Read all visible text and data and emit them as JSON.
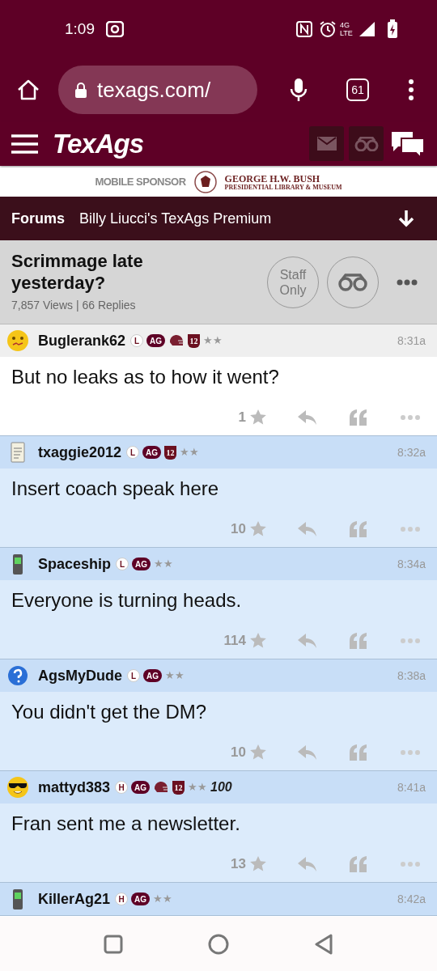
{
  "status_bar": {
    "time": "1:09",
    "network": "4G LTE"
  },
  "browser": {
    "url": "texags.com/",
    "tab_count": "61"
  },
  "site_header": {
    "logo": "TexAgs"
  },
  "sponsor": {
    "label": "MOBILE SPONSOR",
    "name": "GEORGE H.W. BUSH",
    "subtitle": "PRESIDENTIAL LIBRARY & MUSEUM"
  },
  "breadcrumb": {
    "section": "Forums",
    "forum": "Billy Liucci's TexAgs Premium"
  },
  "thread": {
    "title": "Scrimmage late yesterday?",
    "stats": "7,857 Views | 66 Replies",
    "staff_button": "Staff Only"
  },
  "posts": [
    {
      "kind": "op",
      "avatar": {
        "kind": "confused"
      },
      "user": "Buglerank62",
      "badges": [
        {
          "kind": "letter",
          "text": "L"
        },
        {
          "kind": "ag",
          "text": "AG"
        },
        {
          "kind": "helmet"
        },
        {
          "kind": "shield",
          "text": "12"
        },
        {
          "kind": "stars",
          "text": "★★"
        }
      ],
      "time": "8:31a",
      "body": "But no leaks as to how it went?",
      "stars_count": "1"
    },
    {
      "kind": "reply",
      "avatar": {
        "kind": "notepad"
      },
      "user": "txaggie2012",
      "badges": [
        {
          "kind": "letter",
          "text": "L"
        },
        {
          "kind": "ag",
          "text": "AG"
        },
        {
          "kind": "shield",
          "text": "12"
        },
        {
          "kind": "stars",
          "text": "★★"
        }
      ],
      "time": "8:32a",
      "body": "Insert coach speak here",
      "stars_count": "10"
    },
    {
      "kind": "reply",
      "avatar": {
        "kind": "phone"
      },
      "user": "Spaceship",
      "badges": [
        {
          "kind": "letter",
          "text": "L"
        },
        {
          "kind": "ag",
          "text": "AG"
        },
        {
          "kind": "stars",
          "text": "★★"
        }
      ],
      "time": "8:34a",
      "body": "Everyone is turning heads.",
      "stars_count": "114"
    },
    {
      "kind": "reply",
      "avatar": {
        "kind": "question"
      },
      "user": "AgsMyDude",
      "badges": [
        {
          "kind": "letter",
          "text": "L"
        },
        {
          "kind": "ag",
          "text": "AG"
        },
        {
          "kind": "stars",
          "text": "★★"
        }
      ],
      "time": "8:38a",
      "body": "You didn't get the DM?",
      "stars_count": "10"
    },
    {
      "kind": "reply",
      "avatar": {
        "kind": "cool"
      },
      "user": "mattyd383",
      "badges": [
        {
          "kind": "letter",
          "text": "H"
        },
        {
          "kind": "ag",
          "text": "AG"
        },
        {
          "kind": "helmet"
        },
        {
          "kind": "shield",
          "text": "12"
        },
        {
          "kind": "stars",
          "text": "★★"
        },
        {
          "kind": "count",
          "text": "100"
        }
      ],
      "time": "8:41a",
      "body": "Fran sent me a newsletter.",
      "stars_count": "13"
    },
    {
      "kind": "reply",
      "avatar": {
        "kind": "phone"
      },
      "user": "KillerAg21",
      "badges": [
        {
          "kind": "letter",
          "text": "H"
        },
        {
          "kind": "ag",
          "text": "AG"
        },
        {
          "kind": "stars",
          "text": "★★"
        }
      ],
      "time": "8:42a"
    }
  ]
}
